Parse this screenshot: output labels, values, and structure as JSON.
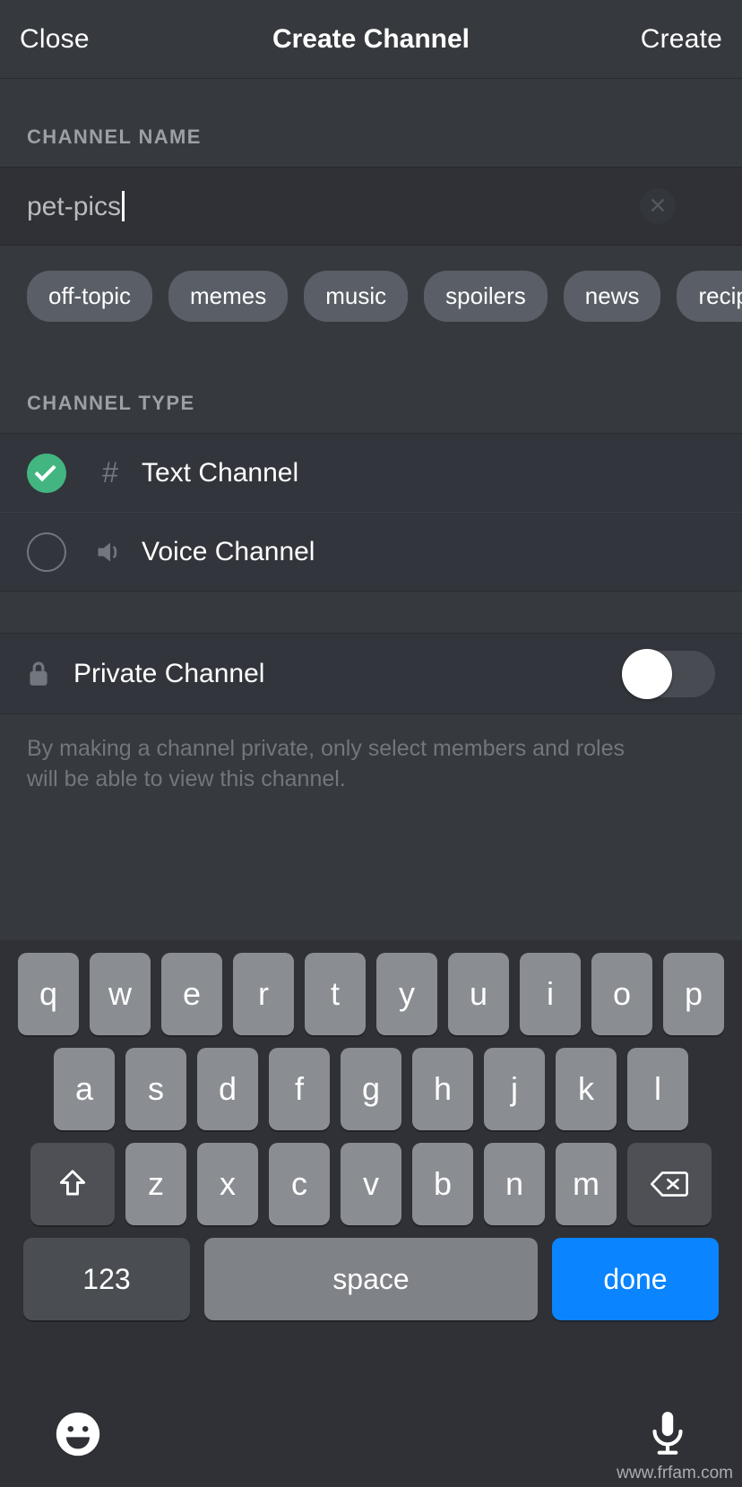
{
  "header": {
    "close_label": "Close",
    "title": "Create Channel",
    "create_label": "Create"
  },
  "channel_name": {
    "section_label": "CHANNEL NAME",
    "value": "pet-pics",
    "clear_icon": "close-circle-icon",
    "suggestions": [
      "off-topic",
      "memes",
      "music",
      "spoilers",
      "news",
      "recipes"
    ]
  },
  "channel_type": {
    "section_label": "CHANNEL TYPE",
    "options": [
      {
        "label": "Text Channel",
        "icon": "hash-icon",
        "selected": true
      },
      {
        "label": "Voice Channel",
        "icon": "speaker-icon",
        "selected": false
      }
    ]
  },
  "private": {
    "label": "Private Channel",
    "icon": "lock-icon",
    "enabled": false,
    "description": "By making a channel private, only select members and roles will be able to view this channel."
  },
  "keyboard": {
    "row1": [
      "q",
      "w",
      "e",
      "r",
      "t",
      "y",
      "u",
      "i",
      "o",
      "p"
    ],
    "row2": [
      "a",
      "s",
      "d",
      "f",
      "g",
      "h",
      "j",
      "k",
      "l"
    ],
    "row3_letters": [
      "z",
      "x",
      "c",
      "v",
      "b",
      "n",
      "m"
    ],
    "shift_icon": "shift-arrow-icon",
    "backspace_icon": "backspace-icon",
    "numbers_label": "123",
    "space_label": "space",
    "done_label": "done"
  },
  "bottom_bar": {
    "emoji_icon": "smiley-face-icon",
    "mic_icon": "microphone-icon"
  },
  "watermark": "www.frfam.com",
  "colors": {
    "background": "#36393e",
    "row_background": "#32353b",
    "input_background": "#2f3136",
    "accent_green": "#43b581",
    "accent_blue": "#0a84ff",
    "chip_background": "#5a5f67",
    "muted_text": "#72767d"
  }
}
